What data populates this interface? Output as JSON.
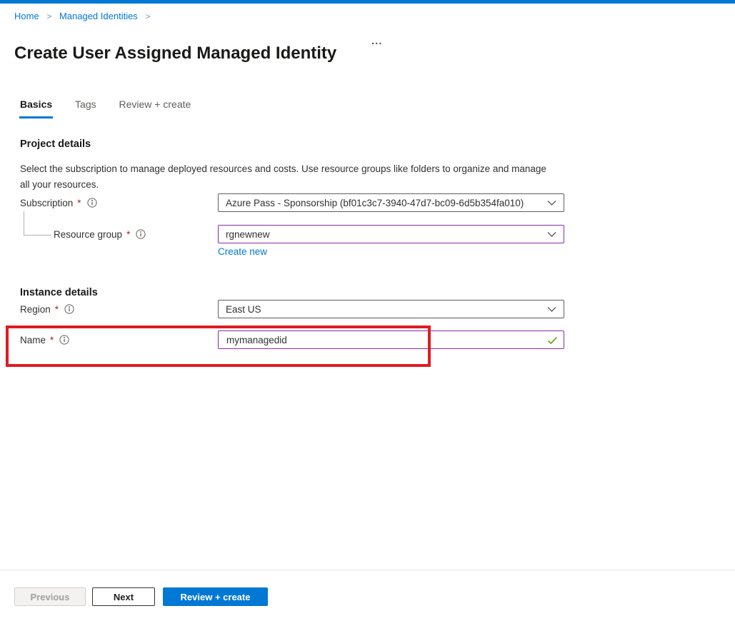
{
  "breadcrumb": {
    "items": [
      {
        "label": "Home"
      },
      {
        "label": "Managed Identities"
      }
    ],
    "separator": ">"
  },
  "header": {
    "title": "Create User Assigned Managed Identity",
    "more_options": "..."
  },
  "tabs": {
    "items": [
      {
        "label": "Basics",
        "active": true
      },
      {
        "label": "Tags",
        "active": false
      },
      {
        "label": "Review + create",
        "active": false
      }
    ]
  },
  "form": {
    "required_mark": "*",
    "project_details": {
      "heading": "Project details",
      "description": "Select the subscription to manage deployed resources and costs. Use resource groups like folders to organize and manage all your resources.",
      "subscription": {
        "label": "Subscription",
        "value": "Azure Pass - Sponsorship (bf01c3c7-3940-47d7-bc09-6d5b354fa010)"
      },
      "resource_group": {
        "label": "Resource group",
        "value": "rgnewnew",
        "create_new_label": "Create new"
      }
    },
    "instance_details": {
      "heading": "Instance details",
      "region": {
        "label": "Region",
        "value": "East US"
      },
      "name": {
        "label": "Name",
        "value": "mymanagedid",
        "validation_state": "valid"
      }
    }
  },
  "footer": {
    "previous_label": "Previous",
    "next_label": "Next",
    "review_create_label": "Review + create"
  },
  "colors": {
    "accent": "#0078d4",
    "link": "#0078d4",
    "required_mark": "#a4262c",
    "focused_field_border": "#8a2da5",
    "valid_check": "#57a300",
    "annotation_red": "#e11b22"
  }
}
